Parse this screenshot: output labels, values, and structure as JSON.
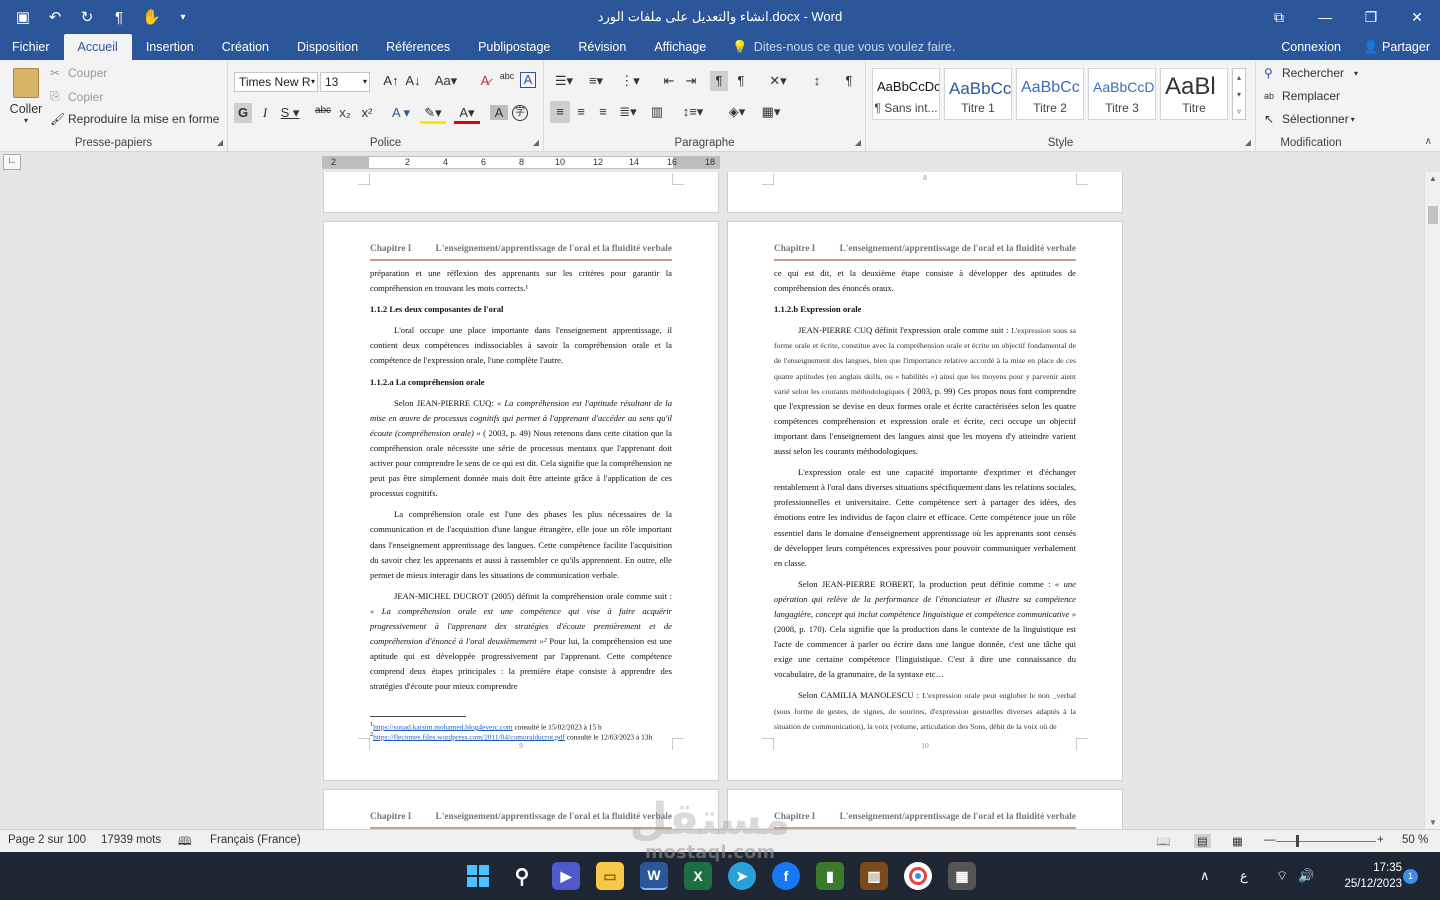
{
  "window": {
    "title": "انشاء والتعديل على ملفات الورد.docx - Word",
    "controls": [
      "⧉",
      "—",
      "❐",
      "✕"
    ]
  },
  "tabs": {
    "file": "Fichier",
    "items": [
      "Accueil",
      "Insertion",
      "Création",
      "Disposition",
      "Références",
      "Publipostage",
      "Révision",
      "Affichage"
    ],
    "tell_me": "Dites-nous ce que vous voulez faire.",
    "signin": "Connexion",
    "share": "Partager"
  },
  "clipboard": {
    "paste": "Coller",
    "cut": "Couper",
    "copy": "Copier",
    "format_painter": "Reproduire la mise en forme",
    "label": "Presse-papiers"
  },
  "font": {
    "name": "Times New R",
    "size": "13",
    "label": "Police"
  },
  "paragraph": {
    "label": "Paragraphe"
  },
  "styles": {
    "items": [
      {
        "preview": "AaBbCcDc",
        "name": "¶ Sans int..."
      },
      {
        "preview": "AaBbCc",
        "name": "Titre 1"
      },
      {
        "preview": "AaBbCc",
        "name": "Titre 2"
      },
      {
        "preview": "AaBbCcD",
        "name": "Titre 3"
      },
      {
        "preview": "AaBl",
        "name": "Titre"
      }
    ],
    "label": "Style"
  },
  "editing": {
    "find": "Rechercher",
    "replace": "Remplacer",
    "select": "Sélectionner",
    "label": "Modification"
  },
  "ruler": {
    "ticks": [
      "2",
      "2",
      "4",
      "6",
      "8",
      "10",
      "12",
      "14",
      "16",
      "18"
    ]
  },
  "header": {
    "chapter": "Chapitre I",
    "title": "L'enseignement/apprentissage de l'oral et la fluidité verbale"
  },
  "page9": {
    "p1": "préparation et une réflexion des apprenants sur les critères pour garantir la compréhension en trouvant les mots corrects.¹",
    "h1": "1.1.2 Les deux composantes de l'oral",
    "p2": "L'oral occupe une place importante dans l'enseignement apprentissage, il contient deux compétences indissociables à savoir la compréhension orale et la compétence de l'expression orale, l'une complète l'autre.",
    "h2": "1.1.2.a La compréhension orale",
    "p3a": "Selon JEAN-PIERRE CUQ: ",
    "p3b": "« La compréhension est l'aptitude résultant de la mise en œuvre de processus cognitifs qui permet à l'apprenant d'accéder au sens qu'il écoute (compréhension orale) »",
    "p3c": " ( 2003, p. 49) Nous retenons dans cette citation que la compréhension orale nécessite une série de processus mentaux que l'apprenant doit activer pour comprendre le sens de ce qui est dit. Cela signifie que la compréhension ne peut pas être simplement donnée mais doit être atteinte grâce à l'application de ces processus cognitifs.",
    "p4": "La compréhension orale est l'une des phases les plus nécessaires de la communication et de l'acquisition d'une langue étrangère, elle joue un rôle important dans l'enseignement apprentissage des langues. Cette compétence facilite l'acquisition du savoir chez les apprenants et aussi à rassembler ce qu'ils apprennent. En outre, elle permet de mieux interagir dans les situations de communication verbale.",
    "p5a": "JEAN-MICHEL DUCROT (2005) définit la compréhension orale comme suit : ",
    "p5b": "« La compréhension orale est une compétence qui vise à faire acquérir progressivement à l'apprenant des stratégies d'écoute premièrement et de compréhension d'énoncé à l'oral deuxièmement »²",
    "p5c": " Pour lui, la compréhension est une aptitude qui est développée progressivement par l'apprenant. Cette compétence comprend deux étapes principales : la première étape consiste à apprendre des stratégies d'écoute pour mieux comprendre",
    "fn1_link": "https://souad.kaisim.mohamed.blog4everc.com",
    "fn1_text": " consulté le 15/02/2023 à 15 h",
    "fn2_link": "https://flecomee.files.wordpress.com/2011/04/comoralducrot.pdf",
    "fn2_text": " consulté le 12/03/2023 à 13h",
    "number": "9"
  },
  "page10": {
    "p1": "ce qui est dit, et la deuxième étape consiste à développer des aptitudes de compréhension des énoncés oraux.",
    "h1": "1.1.2.b Expression orale",
    "p2a": "JEAN-PIERRE CUQ définit l'expression orale comme suit : ",
    "p2b": "L'expression sous sa forme orale et écrite, constitue avec la compréhension orale et écrite un objectif fondamental de de l'enseignement des langues, bien que l'importance relative accordé à la mise en place de ces quatre aptitudes (en anglais skills, ou « habilités ») ainsi que les moyens pour y parvenir aient varié selon les courants méthodologiques",
    "p2c": " ( 2003, p. 99) Ces propos nous font comprendre que l'expression se devise en deux formes orale et écrite caractérisées selon les quatre compétences compréhension et expression orale et écrite, ceci occupe un objectif important dans l'enseignement des langues ainsi que les moyens d'y atteindre varient aussi selon les courants méthodologiques.",
    "p3": "L'expression orale est une capacité importante d'exprimer et d'échanger rentablement à l'oral dans diverses situations spécifiquement dans les relations sociales, professionnelles et universitaire. Cette compétence sert à partager des idées, des émotions entre les individus de façon claire et efficace. Cette compétence joue un rôle essentiel dans le domaine d'enseignement apprentissage où les apprenants sont censés de développer leurs compétences expressives pour pouvoir communiquer verbalement en classe.",
    "p4a": "Selon JEAN-PIERRE ROBERT, la production peut définie comme : ",
    "p4b": "« une opération qui relève de la performance de l'énonciateur et illustre sa compétence langagière, concept qui inclut compétence linguistique et compétence communicative »",
    "p4c": " (2008, p. 170). Cela signifie que la production dans le contexte de la linguistique est l'acte de commencer à parler ou écrire dans une langue donnée, c'est une tâche qui exige une certaine compétence l'linguistique. C'est à dire une connaissance du vocabulaire, de la grammaire, de la syntaxe etc…",
    "p5a": "Selon CAMILIA MANOLESCU : ",
    "p5b": "L'expression orale peut englober le non _verbal (sous forme de gestes, de signes, de sourires, d'expression gestuelles diverses adaptés à la situation de communication), la voix (volume, articulation des Sons, débit de la voix où de",
    "number": "10",
    "top_number": "8"
  },
  "statusbar": {
    "page": "Page 2 sur 100",
    "words": "17939 mots",
    "language": "Français (France)",
    "zoom": "50 %",
    "zoom_level": 0.5
  },
  "watermark": {
    "arabic": "مستقل",
    "latin": "mostaql.com"
  },
  "taskbar": {
    "time": "17:35",
    "date": "25/12/2023",
    "lang": "ع",
    "notifications": "1"
  }
}
